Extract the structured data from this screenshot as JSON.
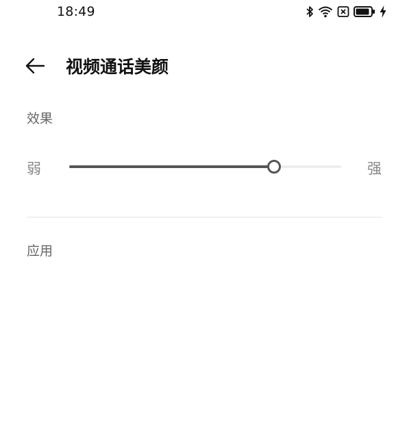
{
  "status_bar": {
    "time": "18:49",
    "icons": [
      "bluetooth-icon",
      "wifi-icon",
      "sim-off-icon",
      "battery-icon",
      "charging-icon"
    ]
  },
  "header": {
    "back_icon": "arrow-left-icon",
    "title": "视频通话美颜"
  },
  "effect": {
    "label": "效果",
    "slider": {
      "min_label": "弱",
      "max_label": "强",
      "value_fraction": 0.75
    }
  },
  "apply": {
    "label": "应用"
  },
  "colors": {
    "slider_fill": "#555555",
    "slider_track": "#eeeeee",
    "section_label": "#666666"
  }
}
